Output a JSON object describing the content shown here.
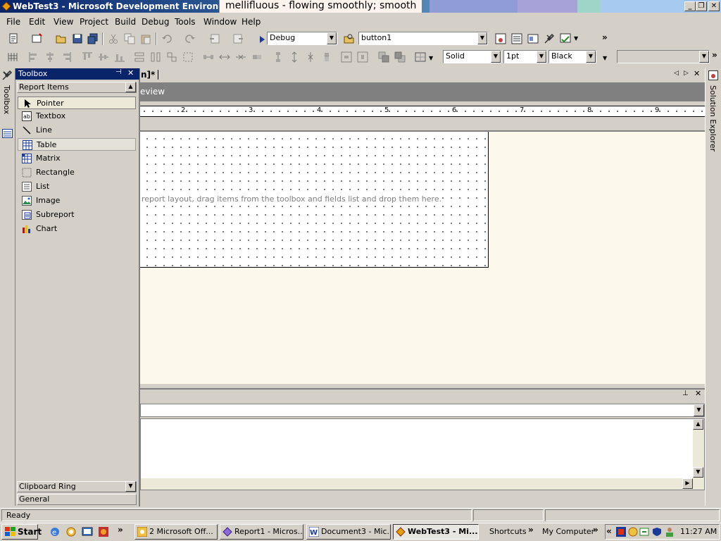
{
  "window": {
    "title": "WebTest3 - Microsoft Development Environment [d",
    "tooltip_word": "mellifluous - flowing smoothly; smooth",
    "colors": {
      "titlebar": "#0a246a",
      "tooltip_bg": "#fff3ee",
      "canvas_bg": "#fdf8ec"
    }
  },
  "menu": [
    "File",
    "Edit",
    "View",
    "Project",
    "Build",
    "Debug",
    "Tools",
    "Window",
    "Help"
  ],
  "toolbar": {
    "config_value": "Debug",
    "find_value": "button1",
    "line_style": "Solid",
    "line_width": "1pt",
    "line_color": "Black"
  },
  "toolbox": {
    "title": "Toolbox",
    "vertical_tab": "Toolbox",
    "section": "Report Items",
    "items": [
      "Pointer",
      "Textbox",
      "Line",
      "Table",
      "Matrix",
      "Rectangle",
      "List",
      "Image",
      "Subreport",
      "Chart"
    ],
    "bottom_sections": [
      "Clipboard Ring",
      "General"
    ]
  },
  "document": {
    "tab_label": "n]*",
    "preview_label": "eview",
    "ruler_ticks": [
      "2",
      "3",
      "4",
      "5",
      "6",
      "7",
      "8",
      "9"
    ],
    "hint": "report layout, drag items from the toolbox and fields list and drop them here."
  },
  "right_strip": {
    "label": "Solution Explorer"
  },
  "status": {
    "text": "Ready"
  },
  "taskbar": {
    "start": "Start",
    "tasks": [
      "2 Microsoft Off...",
      "Report1 - Micros...",
      "Document3 - Mic...",
      "WebTest3 - Mi..."
    ],
    "shortcuts": "Shortcuts",
    "computer": "My Computer",
    "clock": "11:27 AM"
  }
}
